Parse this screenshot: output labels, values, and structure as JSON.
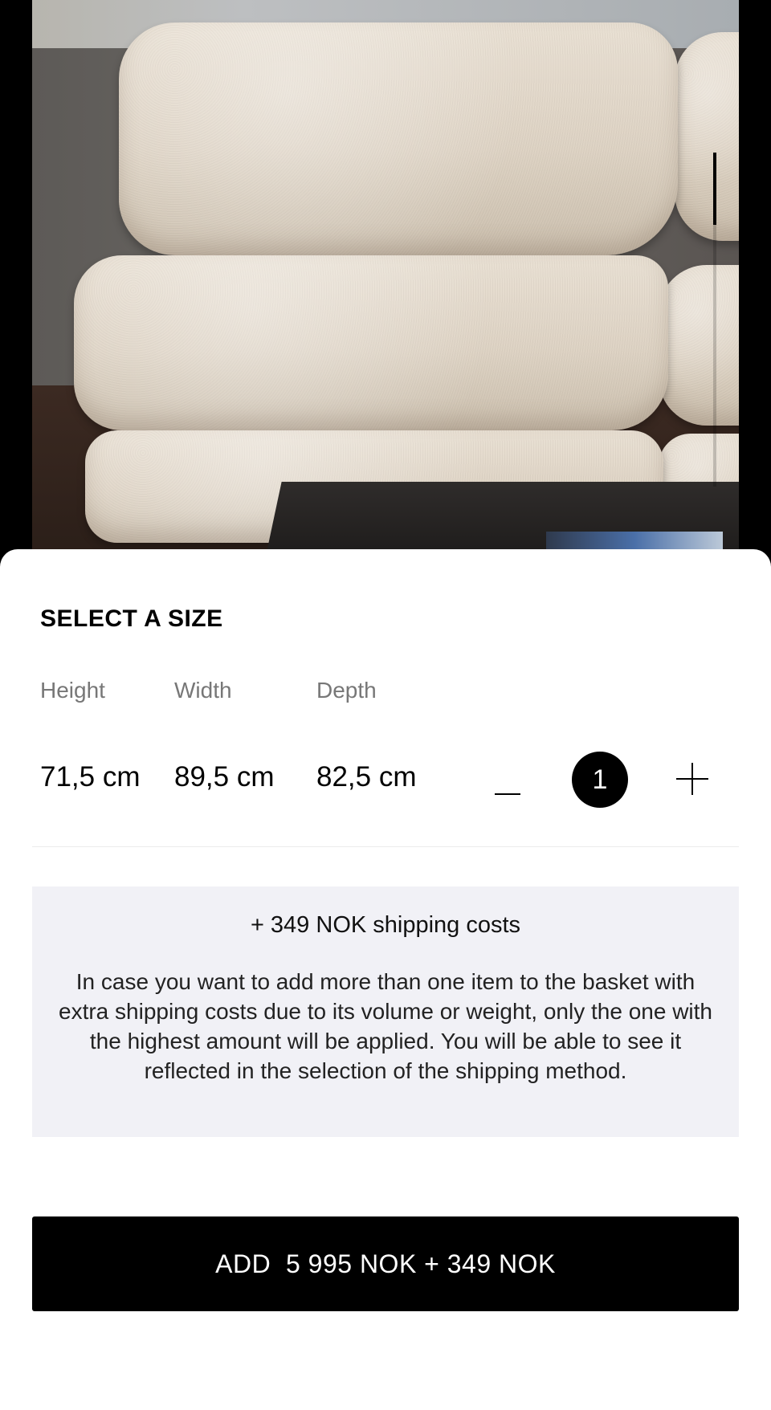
{
  "hero": {
    "image_subject": "cream boucle sofa cushions",
    "pager": {
      "total_pages": 5,
      "active_page": 1
    }
  },
  "size_sheet": {
    "title": "SELECT A SIZE",
    "dimensions": [
      {
        "label": "Height",
        "value": "71,5 cm"
      },
      {
        "label": "Width",
        "value": "89,5 cm"
      },
      {
        "label": "Depth",
        "value": "82,5 cm"
      }
    ],
    "quantity": "1"
  },
  "shipping": {
    "cost_text": "+ 349 NOK shipping costs",
    "note": "In case you want to add more than one item to the basket with extra shipping costs due to its volume or weight, only the one with the highest amount will be applied. You will be able to see it reflected in the selection of the shipping method."
  },
  "add_button": {
    "label": "ADD  5 995 NOK + 349 NOK"
  },
  "colors": {
    "primary": "#000000",
    "sheet_background": "#ffffff",
    "shipping_box_background": "#f1f1f6",
    "muted_text": "#777777"
  }
}
